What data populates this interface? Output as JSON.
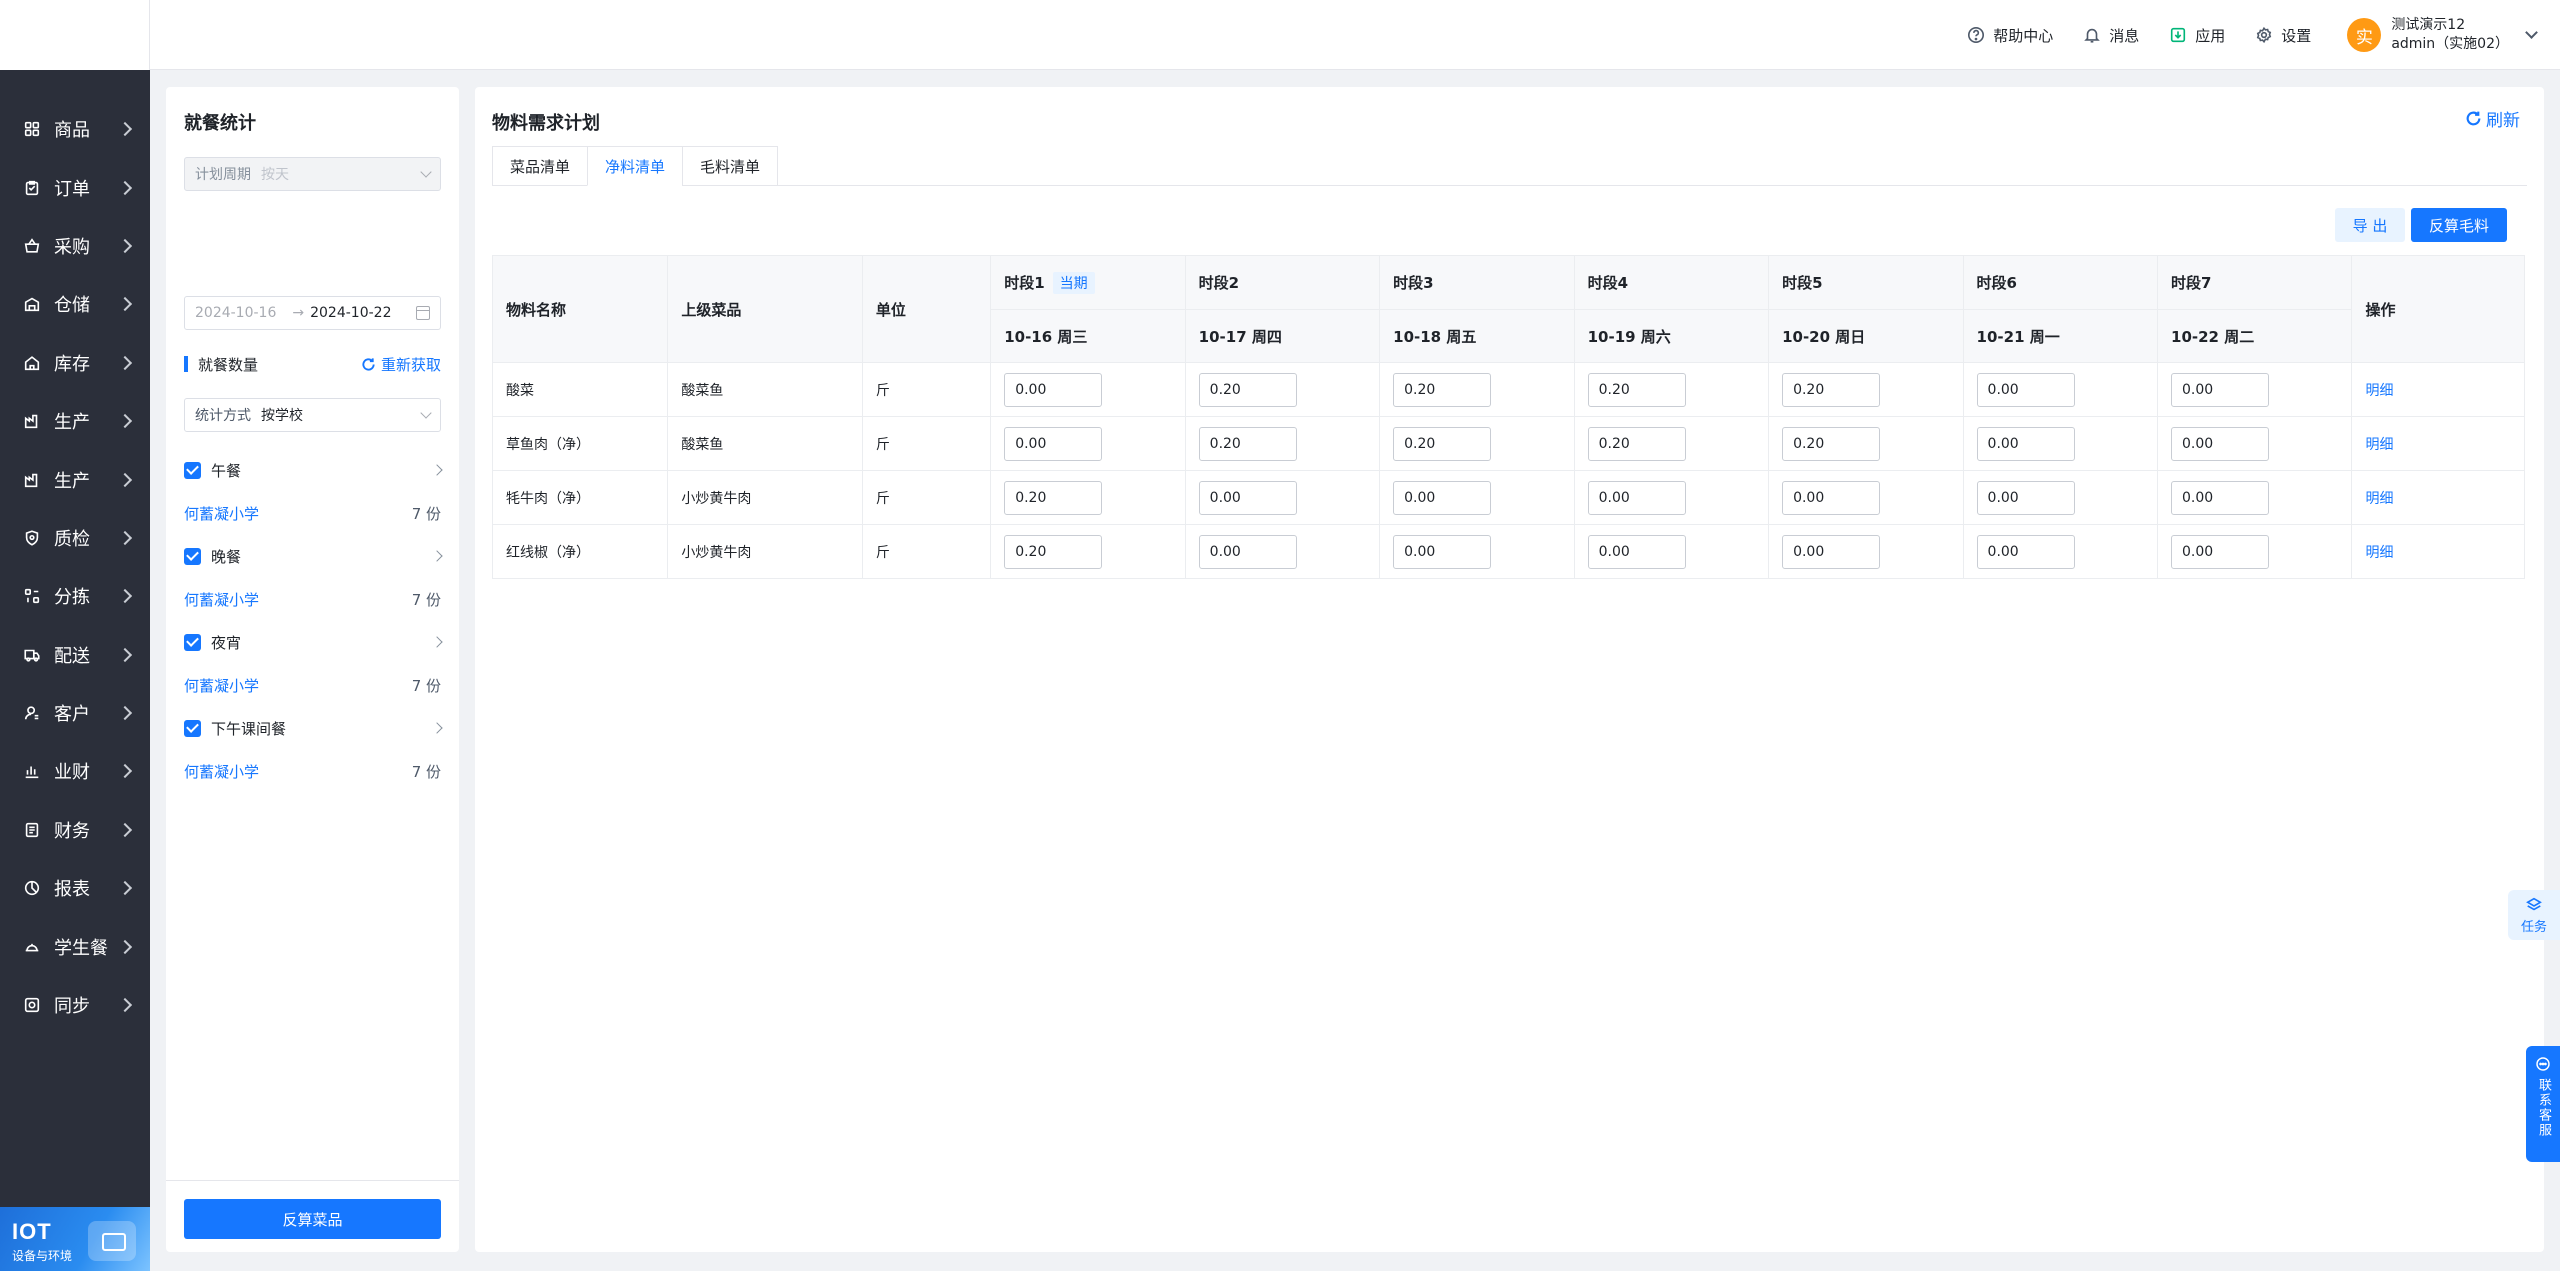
{
  "sidebar": {
    "items": [
      {
        "label": "商品",
        "icon": "grid-icon"
      },
      {
        "label": "订单",
        "icon": "clipboard-icon"
      },
      {
        "label": "采购",
        "icon": "basket-icon"
      },
      {
        "label": "仓储",
        "icon": "warehouse-icon"
      },
      {
        "label": "库存",
        "icon": "home-icon"
      },
      {
        "label": "生产",
        "icon": "factory-icon"
      },
      {
        "label": "生产",
        "icon": "factory-icon"
      },
      {
        "label": "质检",
        "icon": "shield-icon"
      },
      {
        "label": "分拣",
        "icon": "sort-icon"
      },
      {
        "label": "配送",
        "icon": "truck-icon"
      },
      {
        "label": "客户",
        "icon": "user-icon"
      },
      {
        "label": "业财",
        "icon": "chart-icon"
      },
      {
        "label": "财务",
        "icon": "ledger-icon"
      },
      {
        "label": "报表",
        "icon": "pie-icon"
      },
      {
        "label": "学生餐",
        "icon": "dish-icon"
      },
      {
        "label": "同步",
        "icon": "sync-icon"
      }
    ],
    "brand": {
      "title": "IOT",
      "subtitle": "设备与环境"
    }
  },
  "header": {
    "help": "帮助中心",
    "messages": "消息",
    "apps": "应用",
    "settings": "设置",
    "user": {
      "avatar": "实",
      "name": "测试演示12",
      "account": "admin（实施02）"
    }
  },
  "left_panel": {
    "title": "就餐统计",
    "plan_cycle": {
      "label": "计划周期",
      "value": "按天"
    },
    "date_range": {
      "start": "2024-10-16",
      "arrow": "→",
      "end": "2024-10-22"
    },
    "section_title": "就餐数量",
    "refetch": "重新获取",
    "stat_mode": {
      "label": "统计方式",
      "value": "按学校"
    },
    "meals": [
      {
        "name": "午餐",
        "school": "何蓄凝小学",
        "count": "7 份"
      },
      {
        "name": "晚餐",
        "school": "何蓄凝小学",
        "count": "7 份"
      },
      {
        "name": "夜宵",
        "school": "何蓄凝小学",
        "count": "7 份"
      },
      {
        "name": "下午课间餐",
        "school": "何蓄凝小学",
        "count": "7 份"
      }
    ],
    "footer_button": "反算菜品"
  },
  "main": {
    "title": "物料需求计划",
    "refresh": "刷新",
    "tabs": [
      {
        "label": "菜品清单",
        "active": false
      },
      {
        "label": "净料清单",
        "active": true
      },
      {
        "label": "毛料清单",
        "active": false
      }
    ],
    "export": "导 出",
    "reverse": "反算毛料",
    "table": {
      "headers": {
        "name": "物料名称",
        "parent": "上级菜品",
        "unit": "单位",
        "action": "操作"
      },
      "current_tag": "当期",
      "periods": [
        {
          "label": "时段1",
          "date": "10-16 周三"
        },
        {
          "label": "时段2",
          "date": "10-17 周四"
        },
        {
          "label": "时段3",
          "date": "10-18 周五"
        },
        {
          "label": "时段4",
          "date": "10-19 周六"
        },
        {
          "label": "时段5",
          "date": "10-20 周日"
        },
        {
          "label": "时段6",
          "date": "10-21 周一"
        },
        {
          "label": "时段7",
          "date": "10-22 周二"
        }
      ],
      "rows": [
        {
          "name": "酸菜",
          "parent": "酸菜鱼",
          "unit": "斤",
          "values": [
            "0.00",
            "0.20",
            "0.20",
            "0.20",
            "0.20",
            "0.00",
            "0.00"
          ],
          "action": "明细"
        },
        {
          "name": "草鱼肉（净）",
          "parent": "酸菜鱼",
          "unit": "斤",
          "values": [
            "0.00",
            "0.20",
            "0.20",
            "0.20",
            "0.20",
            "0.00",
            "0.00"
          ],
          "action": "明细"
        },
        {
          "name": "牦牛肉（净）",
          "parent": "小炒黄牛肉",
          "unit": "斤",
          "values": [
            "0.20",
            "0.00",
            "0.00",
            "0.00",
            "0.00",
            "0.00",
            "0.00"
          ],
          "action": "明细"
        },
        {
          "name": "红线椒（净）",
          "parent": "小炒黄牛肉",
          "unit": "斤",
          "values": [
            "0.20",
            "0.00",
            "0.00",
            "0.00",
            "0.00",
            "0.00",
            "0.00"
          ],
          "action": "明细"
        }
      ]
    }
  },
  "floating": {
    "task": "任务",
    "customer_service": "联系客服"
  },
  "colors": {
    "primary": "#1677ff",
    "sidebar_bg": "#2b2f3a",
    "avatar_bg": "#ff9a14",
    "apps_green": "#00b578"
  }
}
